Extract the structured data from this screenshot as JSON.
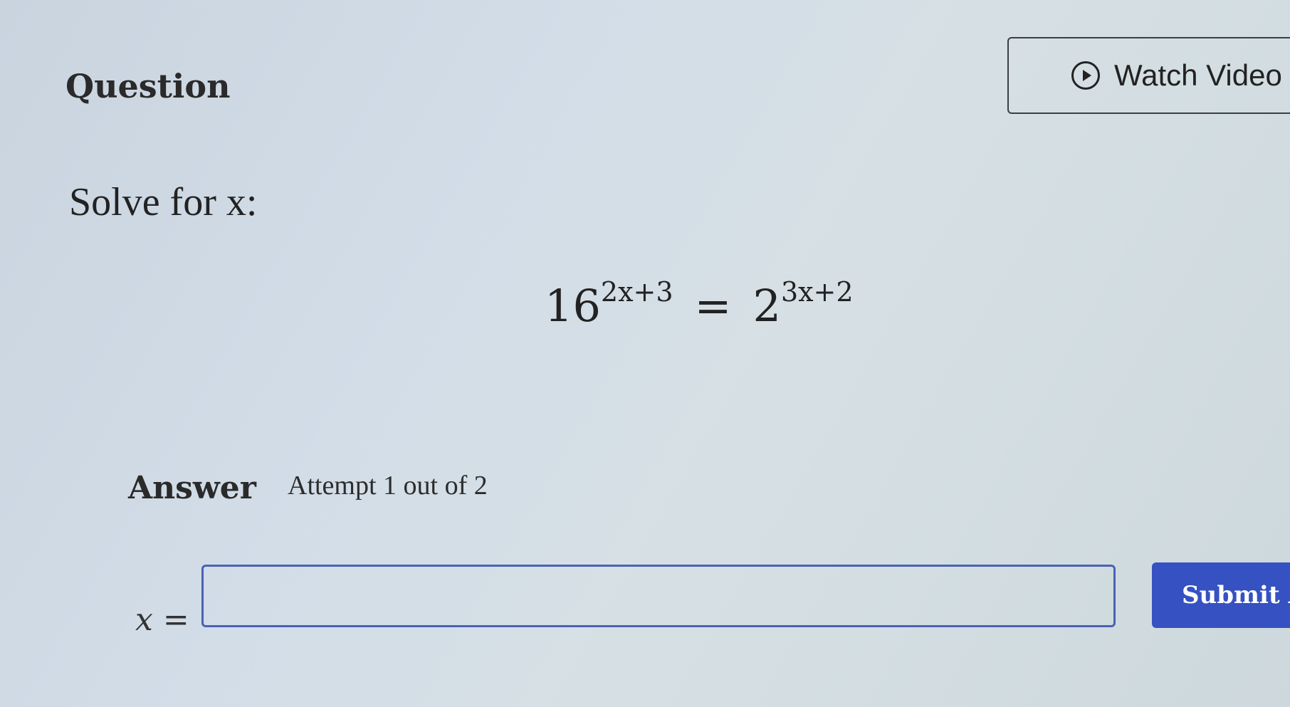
{
  "header": {
    "title": "Question",
    "watch_video_label": "Watch Video",
    "watch_video_icon": "play-circle-icon"
  },
  "question": {
    "prompt": "Solve for x:",
    "equation": {
      "left_base": "16",
      "left_exponent": "2x+3",
      "equals": "=",
      "right_base": "2",
      "right_exponent": "3x+2"
    }
  },
  "answer": {
    "label": "Answer",
    "attempt_text": "Attempt 1 out of 2",
    "variable": "x",
    "equals": "=",
    "input_value": "",
    "submit_label": "Submit A"
  },
  "colors": {
    "accent": "#3551c2",
    "input_border": "#4a62b3"
  }
}
